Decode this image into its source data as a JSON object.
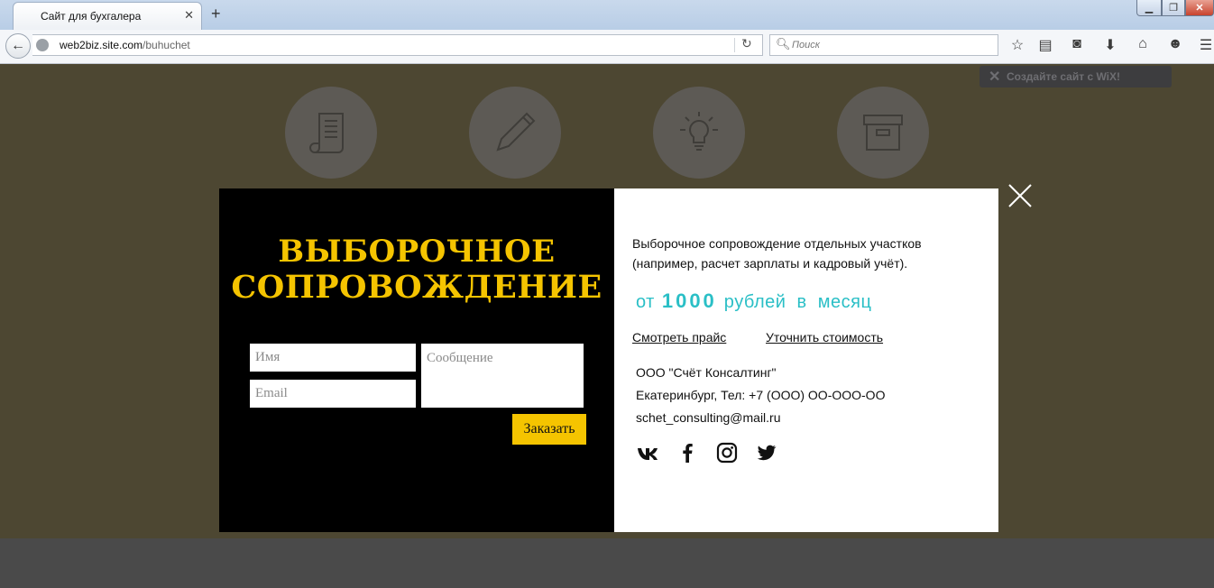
{
  "browser": {
    "tab_title": "Сайт для бухгалера",
    "url_host": "web2biz.site.com",
    "url_prefix": "",
    "url_path": "/buhuchet",
    "search_placeholder": "Поиск",
    "icons": [
      "back-icon",
      "globe-icon",
      "reload-icon",
      "search-icon",
      "bookmark-star-icon",
      "reading-list-icon",
      "pocket-icon",
      "download-icon",
      "home-icon",
      "hello-icon",
      "menu-icon"
    ]
  },
  "wix_banner": {
    "text": "Создайте сайт с WiX!"
  },
  "service_icons": [
    "scroll-icon",
    "pencil-icon",
    "lightbulb-icon",
    "archive-box-icon"
  ],
  "modal": {
    "heading_line1": "ВЫБОРОЧНОЕ",
    "heading_line2": "СОПРОВОЖДЕНИЕ",
    "form": {
      "name_placeholder": "Имя",
      "email_placeholder": "Email",
      "message_placeholder": "Сообщение",
      "submit_label": "Заказать"
    },
    "description": "Выборочное сопровождение отдельных участков (например, расчет зарплаты и кадровый учёт).",
    "price": {
      "prefix": "от",
      "amount": "1000",
      "suffix": "рублей  в  месяц"
    },
    "links": {
      "price_list": "Смотреть прайс",
      "clarify_cost": "Уточнить стоимость"
    },
    "contacts": {
      "company": "ООО \"Счёт Консалтинг\"",
      "address_phone": "Екатеринбург, Тел: +7 (ООО) ОО-ООО-ОО",
      "email": "schet_consulting@mail.ru"
    },
    "social": [
      "vk-icon",
      "facebook-icon",
      "instagram-icon",
      "twitter-icon"
    ],
    "accent_color": "#f5c400",
    "price_color": "#2abfc6"
  }
}
